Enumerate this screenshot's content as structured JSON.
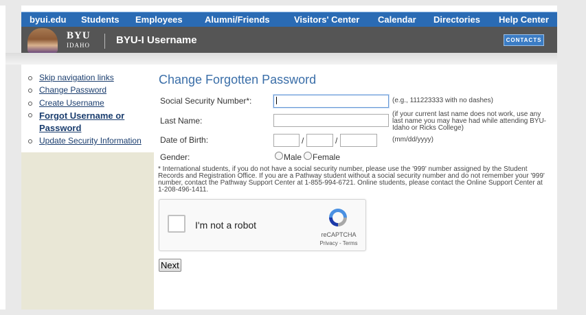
{
  "topnav": {
    "items": [
      "byui.edu",
      "Students",
      "Employees",
      "Alumni/Friends",
      "Visitors' Center",
      "Calendar",
      "Directories",
      "Help Center"
    ]
  },
  "header": {
    "logo_main": "BYU",
    "logo_sub": "IDAHO",
    "title": "BYU-I Username",
    "contacts": "CONTACTS"
  },
  "sidebar": {
    "items": [
      {
        "label": "Skip navigation links"
      },
      {
        "label": "Change Password"
      },
      {
        "label": "Create Username"
      },
      {
        "label": "Forgot Username or",
        "label2": "Password"
      },
      {
        "label": "Update Security Information"
      }
    ]
  },
  "form": {
    "title": "Change Forgotten Password",
    "ssn_label": "Social Security Number*:",
    "ssn_value": "",
    "ssn_hint": "(e.g., 111223333 with no dashes)",
    "lastname_label": "Last Name:",
    "lastname_value": "",
    "lastname_hint": "(if your current last name does not work, use any last name you may have had while attending BYU-Idaho or Ricks College)",
    "dob_label": "Date of Birth:",
    "dob_hint": "(mm/dd/yyyy)",
    "dob_slash": "/",
    "gender_label": "Gender:",
    "gender_male": "Male",
    "gender_female": "Female",
    "note": "* International students, if you do not have a social security number, please use the '999' number assigned by the Student Records and Registration Office. If you are a Pathway student without a social security number and do not remember your '999' number, contact the Pathway Support Center at 1-855-994-6721. Online students, please contact the Online Support Center at 1-208-496-1411.",
    "next": "Next"
  },
  "captcha": {
    "text": "I'm not a robot",
    "brand": "reCAPTCHA",
    "terms": "Privacy - Terms"
  },
  "colors": {
    "nav_blue": "#2a6bb4",
    "header_gray": "#555555",
    "sidebar_tan": "#e9e7d6",
    "title_blue": "#3a6ea8",
    "link_blue": "#1a3d6e"
  }
}
